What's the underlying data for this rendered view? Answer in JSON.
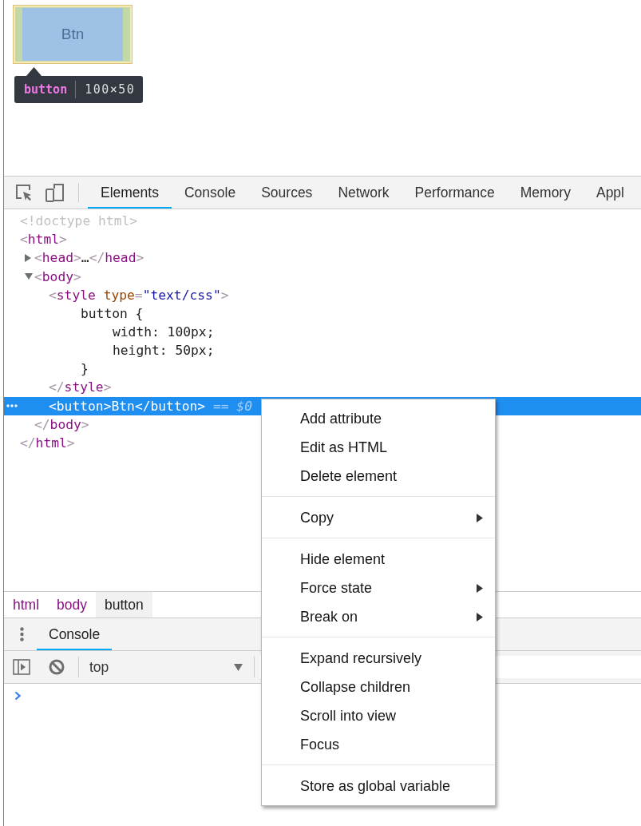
{
  "inspected_page": {
    "button": {
      "label": "Btn",
      "highlighted": true
    },
    "tooltip": {
      "tag": "button",
      "size": "100×50"
    }
  },
  "toolbar": {
    "tabs": [
      {
        "label": "Elements",
        "selected": true
      },
      {
        "label": "Console",
        "selected": false
      },
      {
        "label": "Sources",
        "selected": false
      },
      {
        "label": "Network",
        "selected": false
      },
      {
        "label": "Performance",
        "selected": false
      },
      {
        "label": "Memory",
        "selected": false
      },
      {
        "label": "Appl",
        "selected": false
      }
    ]
  },
  "dom_tree": [
    {
      "kind": "doctype",
      "selected": false,
      "text": "<!doctype html>"
    },
    {
      "kind": "element",
      "selected": false,
      "tokens": [
        {
          "kind": "bracket",
          "text": "<"
        },
        {
          "kind": "tag",
          "text": "html"
        },
        {
          "kind": "bracket",
          "text": ">"
        }
      ],
      "close": [
        {
          "kind": "bracket",
          "text": "</"
        },
        {
          "kind": "tag",
          "text": "html"
        },
        {
          "kind": "bracket",
          "text": ">"
        }
      ],
      "children": [
        {
          "kind": "element",
          "selected": false,
          "expanded": false,
          "tokens": [
            {
              "kind": "bracket",
              "text": "<"
            },
            {
              "kind": "tag",
              "text": "head"
            },
            {
              "kind": "bracket",
              "text": ">"
            },
            {
              "kind": "text",
              "text": "…"
            },
            {
              "kind": "bracket",
              "text": "</"
            },
            {
              "kind": "tag",
              "text": "head"
            },
            {
              "kind": "bracket",
              "text": ">"
            }
          ]
        },
        {
          "kind": "element",
          "selected": false,
          "expanded": true,
          "tokens": [
            {
              "kind": "bracket",
              "text": "<"
            },
            {
              "kind": "tag",
              "text": "body"
            },
            {
              "kind": "bracket",
              "text": ">"
            }
          ],
          "close": [
            {
              "kind": "bracket",
              "text": "</"
            },
            {
              "kind": "tag",
              "text": "body"
            },
            {
              "kind": "bracket",
              "text": ">"
            }
          ],
          "children": [
            {
              "kind": "element",
              "selected": false,
              "tokens": [
                {
                  "kind": "bracket",
                  "text": "<"
                },
                {
                  "kind": "tag",
                  "text": "style"
                },
                {
                  "kind": "attr",
                  "text": "type"
                },
                {
                  "kind": "punct",
                  "text": "="
                },
                {
                  "kind": "value",
                  "text": "\"text/css\""
                },
                {
                  "kind": "bracket",
                  "text": ">"
                }
              ],
              "close": [
                {
                  "kind": "bracket",
                  "text": "</"
                },
                {
                  "kind": "tag",
                  "text": "style"
                },
                {
                  "kind": "bracket",
                  "text": ">"
                }
              ],
              "children": [
                {
                  "kind": "text",
                  "selected": false,
                  "lines": [
                    {
                      "text": "button {",
                      "children": [
                        {
                          "text": "width: 100px;"
                        },
                        {
                          "text": "height: 50px;"
                        }
                      ]
                    },
                    {
                      "text": "}"
                    }
                  ]
                }
              ]
            },
            {
              "kind": "element",
              "selected": true,
              "tokens": [
                {
                  "kind": "bracket",
                  "text": "<"
                },
                {
                  "kind": "tag",
                  "text": "button"
                },
                {
                  "kind": "bracket",
                  "text": ">"
                },
                {
                  "kind": "text",
                  "text": "Btn"
                },
                {
                  "kind": "bracket",
                  "text": "</"
                },
                {
                  "kind": "tag",
                  "text": "button"
                },
                {
                  "kind": "bracket",
                  "text": ">"
                },
                {
                  "kind": "ref",
                  "text": "== $0"
                }
              ]
            }
          ]
        }
      ]
    }
  ],
  "breadcrumbs": [
    {
      "label": "html",
      "selected": false
    },
    {
      "label": "body",
      "selected": false
    },
    {
      "label": "button",
      "selected": true
    }
  ],
  "drawer": {
    "tabs": [
      {
        "label": "Console",
        "selected": true
      }
    ],
    "context": "top"
  },
  "context_menu": {
    "groups": [
      {
        "items": [
          {
            "label": "Add attribute",
            "submenu": false
          },
          {
            "label": "Edit as HTML",
            "submenu": false
          },
          {
            "label": "Delete element",
            "submenu": false
          }
        ]
      },
      {
        "items": [
          {
            "label": "Copy",
            "submenu": true
          }
        ]
      },
      {
        "items": [
          {
            "label": "Hide element",
            "submenu": false
          },
          {
            "label": "Force state",
            "submenu": true
          },
          {
            "label": "Break on",
            "submenu": true
          }
        ]
      },
      {
        "items": [
          {
            "label": "Expand recursively",
            "submenu": false
          },
          {
            "label": "Collapse children",
            "submenu": false
          },
          {
            "label": "Scroll into view",
            "submenu": false
          },
          {
            "label": "Focus",
            "submenu": false
          }
        ]
      },
      {
        "items": [
          {
            "label": "Store as global variable",
            "submenu": false
          }
        ]
      }
    ]
  }
}
